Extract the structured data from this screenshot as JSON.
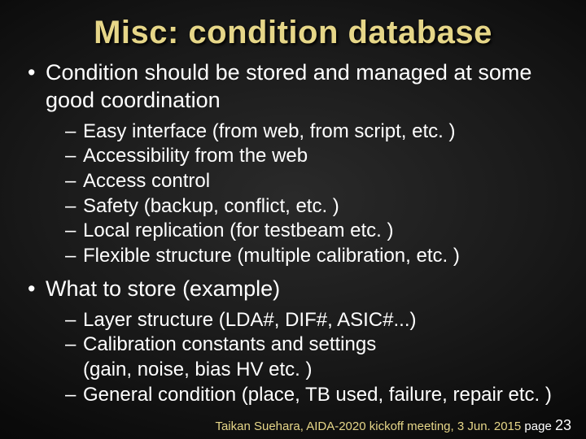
{
  "title": "Misc: condition database",
  "bullets": [
    {
      "text": "Condition should be stored and managed at some good coordination",
      "sub": [
        "Easy interface (from web, from script, etc. )",
        "Accessibility from the web",
        "Access control",
        "Safety (backup, conflict, etc. )",
        "Local replication (for testbeam etc. )",
        "Flexible structure (multiple calibration, etc. )"
      ]
    },
    {
      "text": "What to store (example)",
      "sub": [
        "Layer structure (LDA#, DIF#, ASIC#...)",
        "Calibration constants and settings\n(gain, noise, bias HV etc. )",
        "General condition (place, TB used, failure, repair etc. )"
      ]
    }
  ],
  "footer": {
    "credit": "Taikan Suehara, AIDA-2020 kickoff meeting, 3 Jun. 2015",
    "page_label": "page",
    "page_num": "23"
  }
}
